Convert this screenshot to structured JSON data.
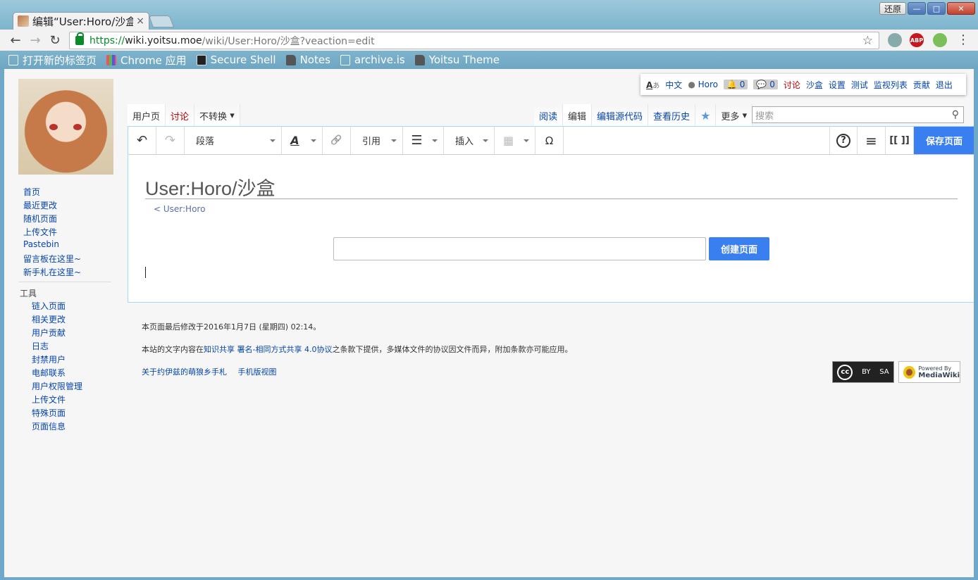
{
  "window": {
    "tab_title": "编辑“User:Horo/沙盒",
    "tab_close": "×",
    "restore_label": "还原",
    "min_label": "—",
    "max_label": "□",
    "close_label": "✕"
  },
  "toolbar": {
    "back": "←",
    "forward": "→",
    "reload": "↻",
    "url_scheme": "https://",
    "url_host": "wiki.yoitsu.moe",
    "url_path": "/wiki/User:Horo/沙盒?veaction=edit",
    "bookmark_star": "☆",
    "ext_abp": "ABP",
    "menu": "⋮"
  },
  "bookmarks": [
    {
      "label": "打开新的标签页",
      "icon": "page-icon"
    },
    {
      "label": "Chrome 应用",
      "icon": "apps-icon"
    },
    {
      "label": "Secure Shell",
      "icon": "shell-icon"
    },
    {
      "label": "Notes",
      "icon": "folder-icon"
    },
    {
      "label": "archive.is",
      "icon": "page-icon"
    },
    {
      "label": "Yoitsu Theme",
      "icon": "folder-icon"
    }
  ],
  "personal": {
    "lang_icon": "A",
    "lang_icon_kana": "あ",
    "language": "中文",
    "username": "Horo",
    "notif_alerts": "0",
    "notif_messages": "0",
    "talk": "讨论",
    "sandbox": "沙盒",
    "preferences": "设置",
    "beta": "测试",
    "watchlist": "监视列表",
    "contributions": "贡献",
    "logout": "退出"
  },
  "sidebar": {
    "nav": [
      "首页",
      "最近更改",
      "随机页面",
      "上传文件",
      "Pastebin",
      "留言板在这里~",
      "新手札在这里~"
    ],
    "tools_title": "工具",
    "tools": [
      "链入页面",
      "相关更改",
      "用户贡献",
      "日志",
      "封禁用户",
      "电邮联系",
      "用户权限管理",
      "上传文件",
      "特殊页面",
      "页面信息"
    ]
  },
  "tabs": {
    "left": {
      "user_page": "用户页",
      "talk": "讨论",
      "variant": "不转换"
    },
    "right": {
      "read": "阅读",
      "edit": "编辑",
      "edit_source": "编辑源代码",
      "history": "查看历史",
      "more": "更多"
    }
  },
  "search": {
    "placeholder": "搜索",
    "icon": "⚲"
  },
  "editor": {
    "undo": "↶",
    "redo": "↷",
    "paragraph": "段落",
    "text_style": "A",
    "link": "🔗",
    "cite": "引用",
    "list": "☰",
    "insert": "插入",
    "table": "▦",
    "special_char": "Ω",
    "help": "?",
    "page_options": "≡",
    "source_switch": "[[ ]]",
    "save": "保存页面"
  },
  "page": {
    "heading": "User:Horo/沙盒",
    "subpage_link": "< User:Horo",
    "create_button": "创建页面"
  },
  "footer": {
    "last_modified": "本页面最后修改于2016年1月7日 (星期四) 02:14。",
    "license_pre": "本站的文字内容在",
    "license_link": "知识共享 署名-相同方式共享 4.0协议",
    "license_post": "之条款下提供，多媒体文件的协议因文件而异，附加条款亦可能应用。",
    "about": "关于约伊兹的萌狼乡手札",
    "mobile": "手机版视图",
    "cc_label": "cc",
    "cc_by": "BY",
    "cc_sa": "SA",
    "mw_powered": "Powered By",
    "mw_name": "MediaWiki"
  }
}
